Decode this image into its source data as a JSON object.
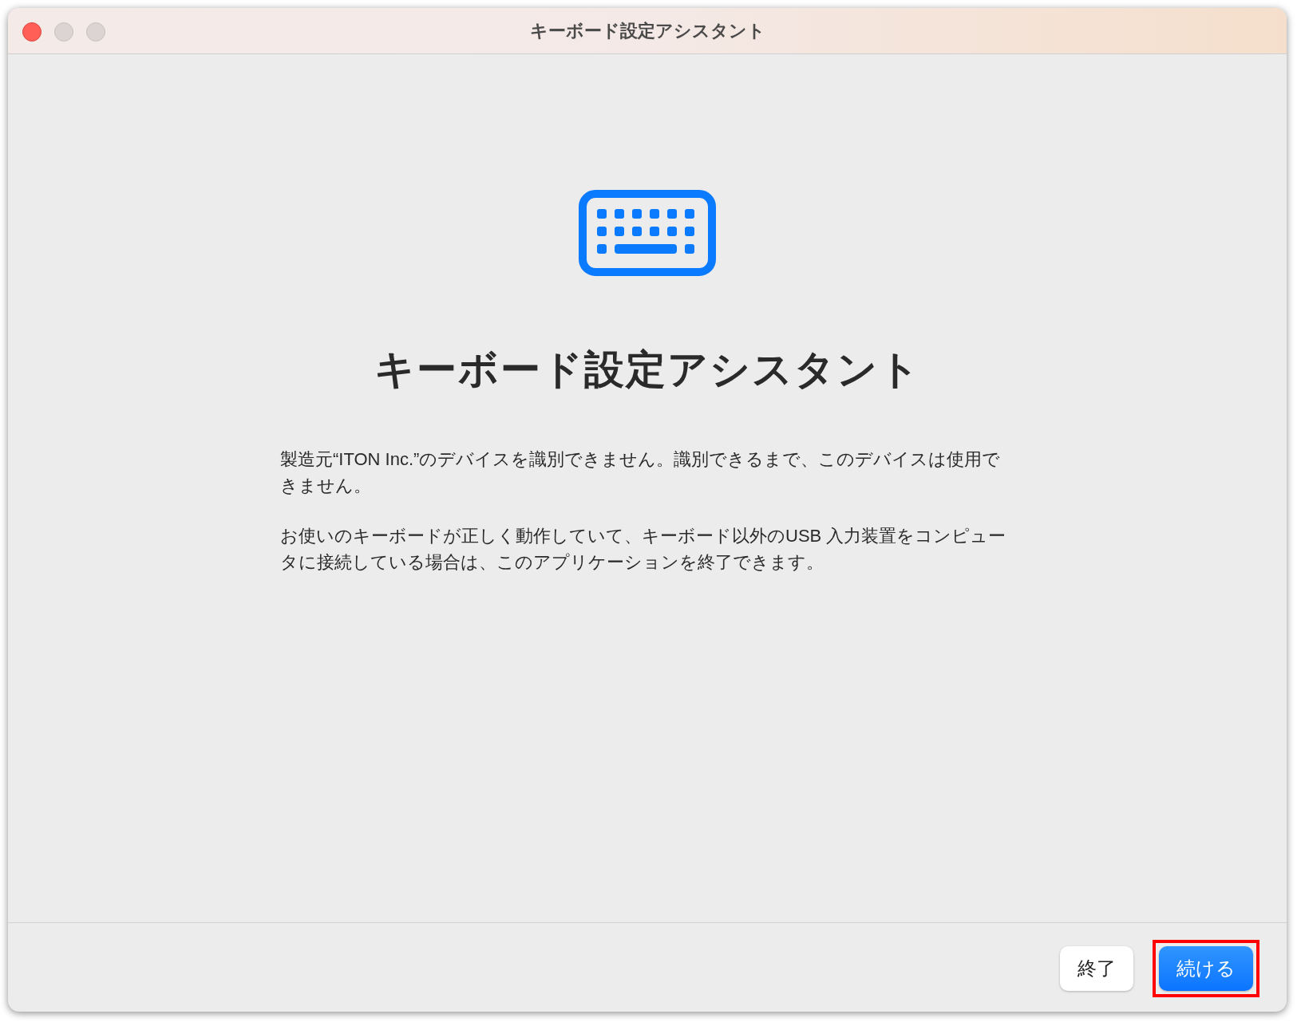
{
  "window": {
    "title": "キーボード設定アシスタント",
    "controls": [
      {
        "kind": "close",
        "enabled": true
      },
      {
        "kind": "minimize",
        "enabled": false
      },
      {
        "kind": "zoom",
        "enabled": false
      }
    ]
  },
  "heading": "キーボード設定アシスタント",
  "paragraphs": [
    "製造元“ITON Inc.”のデバイスを識別できません。識別できるまで、このデバイスは使用できません。",
    "お使いのキーボードが正しく動作していて、キーボード以外のUSB 入力装置をコンピュータに接続している場合は、このアプリケーションを終了できます。"
  ],
  "buttons": [
    {
      "label": "終了",
      "kind": "secondary",
      "highlighted": false
    },
    {
      "label": "続ける",
      "kind": "primary",
      "highlighted": true
    }
  ]
}
